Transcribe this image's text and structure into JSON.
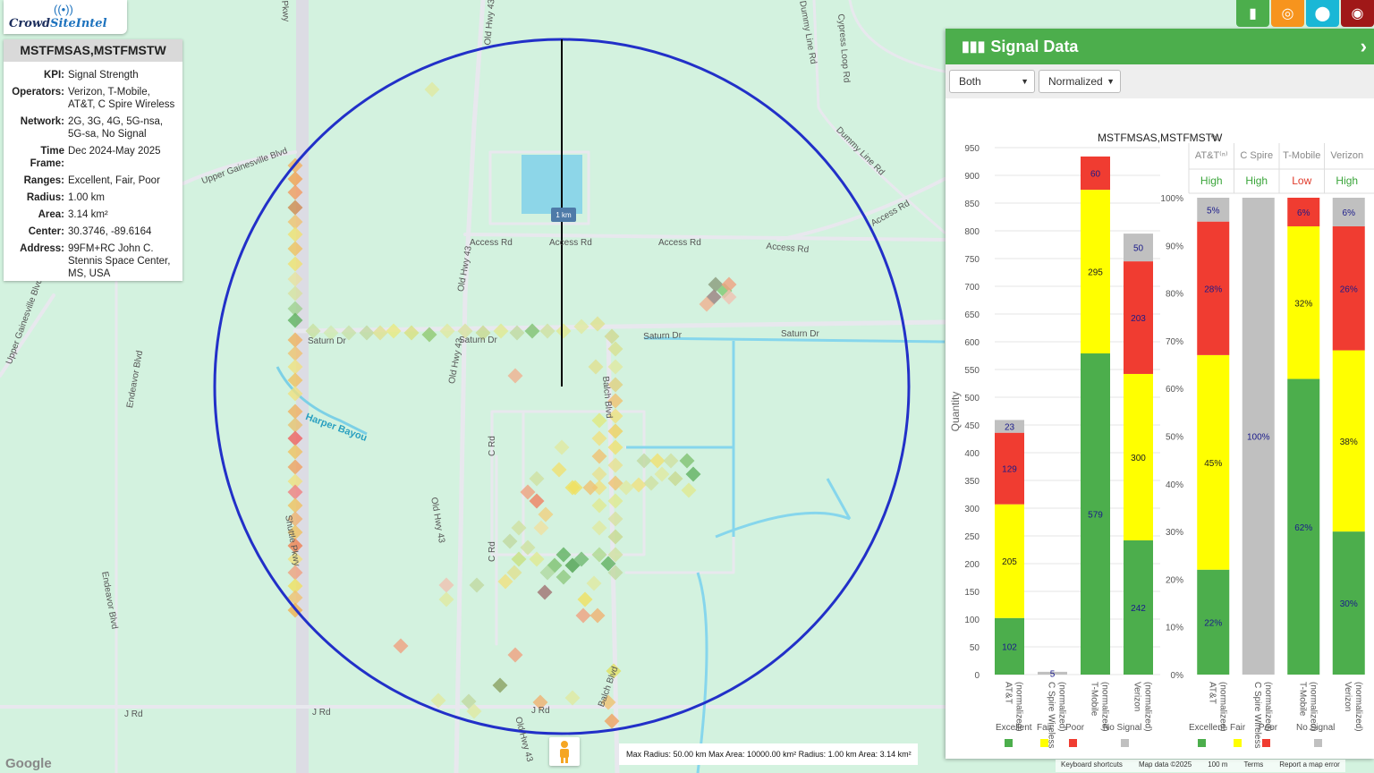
{
  "app": {
    "name_part1": "Crowd",
    "name_part2": "SiteIntel"
  },
  "info": {
    "title": "MSTFMSAS,MSTFMSTW",
    "rows": [
      {
        "k": "KPI:",
        "v": "Signal Strength"
      },
      {
        "k": "Operators:",
        "v": "Verizon, T-Mobile, AT&T, C Spire Wireless"
      },
      {
        "k": "Network:",
        "v": "2G, 3G, 4G, 5G-nsa, 5G-sa, No Signal"
      },
      {
        "k": "Time Frame:",
        "v": "Dec 2024-May 2025"
      },
      {
        "k": "Ranges:",
        "v": "Excellent, Fair, Poor"
      },
      {
        "k": "Radius:",
        "v": "1.00 km"
      },
      {
        "k": "Area:",
        "v": "3.14 km²"
      },
      {
        "k": "Center:",
        "v": "30.3746, -89.6164"
      },
      {
        "k": "Address:",
        "v": "99FM+RC John C. Stennis Space Center, MS, USA"
      }
    ]
  },
  "topbar": {
    "buttons": [
      {
        "icon": "bar-chart-icon",
        "color": "#4cae4c"
      },
      {
        "icon": "target-icon",
        "color": "#f7941d"
      },
      {
        "icon": "map-pin-icon",
        "color": "#1ab7d6"
      },
      {
        "icon": "globe-icon",
        "color": "#a01818"
      }
    ]
  },
  "panel": {
    "title": "Signal Data",
    "select_mode": "Both",
    "select_scale": "Normalized",
    "chart_title": "MSTFMSAS,MSTFMSTW",
    "legend": [
      "Excellent",
      "Fair",
      "Poor",
      "No Signal"
    ]
  },
  "map": {
    "scale_label": "1 km",
    "bottom_info": "Max Radius: 50.00 km  Max Area: 10000.00 km²  Radius: 1.00 km  Area: 3.14 km²",
    "google": "Google",
    "attrib": [
      "Keyboard shortcuts",
      "Map data ©2025",
      "100 m",
      "Terms",
      "Report a map error"
    ],
    "labels": [
      {
        "t": "Upper Gainesville Blvd"
      },
      {
        "t": "Access Rd"
      },
      {
        "t": "Access Rd"
      },
      {
        "t": "Access Rd"
      },
      {
        "t": "Access Rd"
      },
      {
        "t": "Access Rd"
      },
      {
        "t": "Saturn Dr"
      },
      {
        "t": "Saturn Dr"
      },
      {
        "t": "Saturn Dr"
      },
      {
        "t": "Saturn Dr"
      },
      {
        "t": "Harper Bayou"
      },
      {
        "t": "Old Hwy 43"
      },
      {
        "t": "Old Hwy 43"
      },
      {
        "t": "Old Hwy 43"
      },
      {
        "t": "Old Hwy 43"
      },
      {
        "t": "Old Hwy 43"
      },
      {
        "t": "C Rd"
      },
      {
        "t": "C Rd"
      },
      {
        "t": "J Rd"
      },
      {
        "t": "J Rd"
      },
      {
        "t": "J Rd"
      },
      {
        "t": "Balch Blvd"
      },
      {
        "t": "Balch Blvd"
      },
      {
        "t": "Endeavor Blvd"
      },
      {
        "t": "Endeavor Blvd"
      },
      {
        "t": "Upper Gainesville Blvd"
      },
      {
        "t": "Dummy Line Rd"
      },
      {
        "t": "Dummy Line Rd"
      },
      {
        "t": "Cypress Loop Rd"
      },
      {
        "t": "Shuttle Pkwy"
      },
      {
        "t": "Pkwy"
      }
    ]
  },
  "colors": {
    "excellent": "#4cae4c",
    "fair": "#ffff00",
    "poor": "#f03c31",
    "nosignal": "#c0c0c0",
    "circle": "#2230c8"
  },
  "chart_data": [
    {
      "type": "bar",
      "title": "MSTFMSAS,MSTFMSTW",
      "ylabel": "Quantity",
      "ylim": [
        0,
        950
      ],
      "categories": [
        "AT&T (normalized)",
        "C Spire Wireless (normalized)",
        "T-Mobile (normalized)",
        "Verizon (normalized)"
      ],
      "series": [
        {
          "name": "Excellent",
          "values": [
            102,
            0,
            579,
            242
          ]
        },
        {
          "name": "Fair",
          "values": [
            205,
            0,
            295,
            300
          ]
        },
        {
          "name": "Poor",
          "values": [
            129,
            0,
            60,
            203
          ]
        },
        {
          "name": "No Signal",
          "values": [
            23,
            5,
            0,
            50
          ]
        }
      ]
    },
    {
      "type": "bar",
      "stacked_percent": true,
      "ylim": [
        0,
        100
      ],
      "columns": [
        "AT&T⁽ⁿ⁾",
        "C Spire",
        "T-Mobile",
        "Verizon"
      ],
      "ratings": [
        "High",
        "High",
        "Low",
        "High"
      ],
      "categories": [
        "AT&T (normalized)",
        "C Spire Wireless (normalized)",
        "T-Mobile (normalized)",
        "Verizon (normalized)"
      ],
      "series": [
        {
          "name": "Excellent",
          "values": [
            22,
            0,
            62,
            30
          ]
        },
        {
          "name": "Fair",
          "values": [
            45,
            0,
            32,
            38
          ]
        },
        {
          "name": "Poor",
          "values": [
            28,
            0,
            6,
            26
          ]
        },
        {
          "name": "No Signal",
          "values": [
            5,
            100,
            0,
            6
          ]
        }
      ]
    }
  ]
}
